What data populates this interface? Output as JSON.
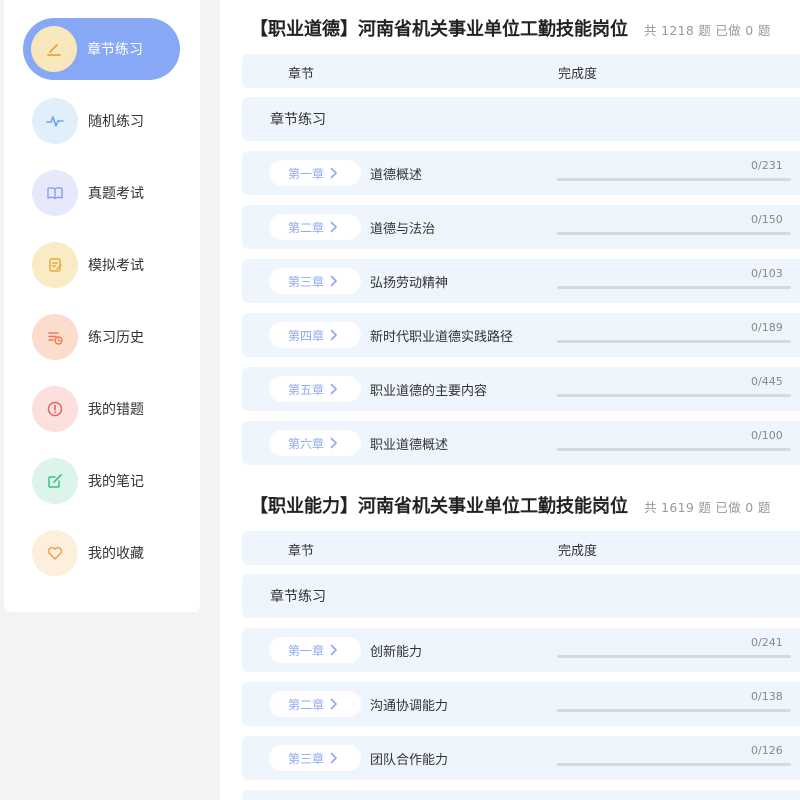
{
  "sidebar": {
    "items": [
      {
        "label": "章节练习",
        "icon": "pencil-icon",
        "active": true
      },
      {
        "label": "随机练习",
        "icon": "pulse-icon"
      },
      {
        "label": "真题考试",
        "icon": "book-icon"
      },
      {
        "label": "模拟考试",
        "icon": "exam-sheet-icon"
      },
      {
        "label": "练习历史",
        "icon": "history-icon"
      },
      {
        "label": "我的错题",
        "icon": "alert-icon"
      },
      {
        "label": "我的笔记",
        "icon": "note-icon"
      },
      {
        "label": "我的收藏",
        "icon": "heart-icon"
      }
    ]
  },
  "sections": [
    {
      "title": "【职业道德】河南省机关事业单位工勤技能岗位",
      "meta": "共 1218 题 已做 0 题",
      "header_chapter": "章节",
      "header_progress": "完成度",
      "group_label": "章节练习",
      "rows": [
        {
          "chapter": "第一章",
          "name": "道德概述",
          "count": "0/231",
          "progress": 0
        },
        {
          "chapter": "第二章",
          "name": "道德与法治",
          "count": "0/150",
          "progress": 0
        },
        {
          "chapter": "第三章",
          "name": "弘扬劳动精神",
          "count": "0/103",
          "progress": 0
        },
        {
          "chapter": "第四章",
          "name": "新时代职业道德实践路径",
          "count": "0/189",
          "progress": 0
        },
        {
          "chapter": "第五章",
          "name": "职业道德的主要内容",
          "count": "0/445",
          "progress": 0
        },
        {
          "chapter": "第六章",
          "name": "职业道德概述",
          "count": "0/100",
          "progress": 0
        }
      ]
    },
    {
      "title": "【职业能力】河南省机关事业单位工勤技能岗位",
      "meta": "共 1619 题 已做 0 题",
      "header_chapter": "章节",
      "header_progress": "完成度",
      "group_label": "章节练习",
      "rows": [
        {
          "chapter": "第一章",
          "name": "创新能力",
          "count": "0/241",
          "progress": 0
        },
        {
          "chapter": "第二章",
          "name": "沟通协调能力",
          "count": "0/138",
          "progress": 0
        },
        {
          "chapter": "第三章",
          "name": "团队合作能力",
          "count": "0/126",
          "progress": 0
        }
      ]
    }
  ],
  "colors": {
    "accent": "#87a8f4",
    "row_bg": "#eef5fd",
    "chapter_text": "#8fa9ee"
  }
}
